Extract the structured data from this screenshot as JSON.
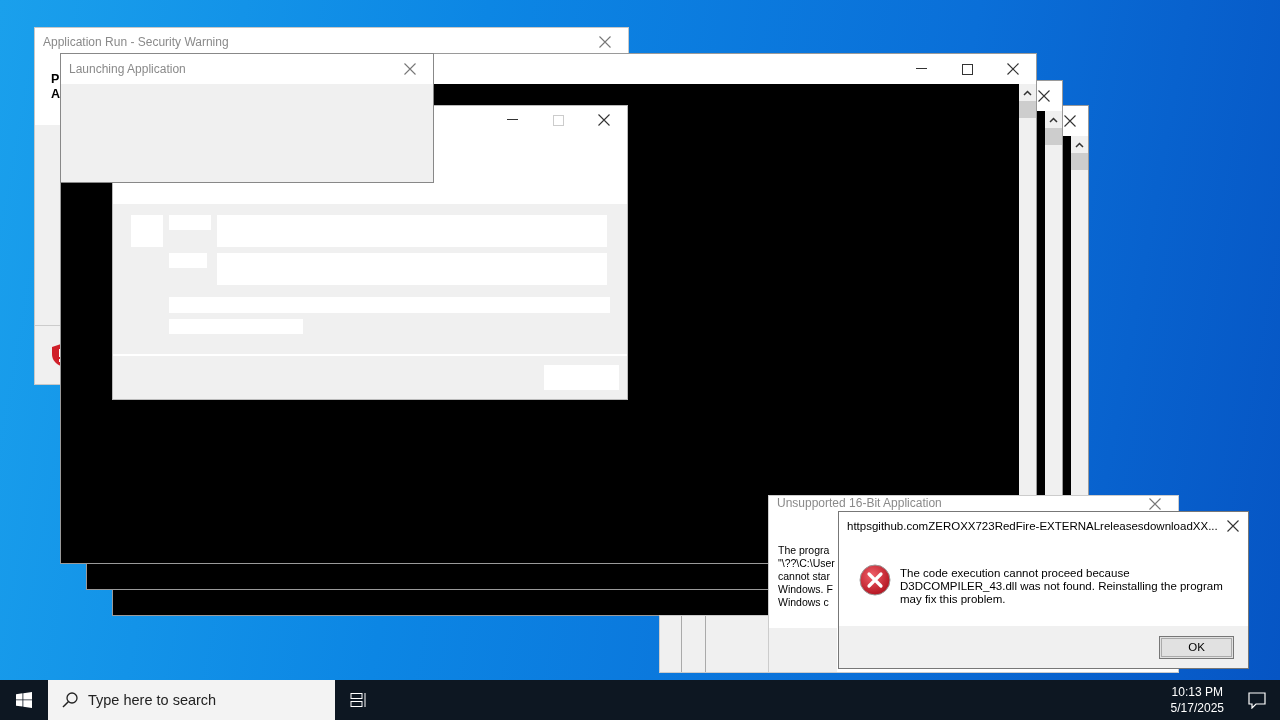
{
  "desktop": {
    "windows": [
      {
        "kind": "security",
        "title": "Application Run - Security Warning",
        "active": false,
        "heading_lines": [
          "P",
          "A"
        ]
      },
      {
        "kind": "console"
      },
      {
        "kind": "console"
      },
      {
        "kind": "console"
      },
      {
        "kind": "loading"
      },
      {
        "kind": "launching",
        "title": "Launching Application",
        "active": false
      },
      {
        "kind": "blank"
      },
      {
        "kind": "message",
        "title": "Unsupported 16-Bit Application",
        "active": false,
        "lines": [
          "The progra",
          "\"\\??\\C:\\User",
          "cannot star",
          "Windows. F",
          "Windows c"
        ]
      },
      {
        "kind": "error",
        "title": "httpsgithub.comZEROXX723RedFire-EXTERNALreleasesdownloadXX...",
        "active": true,
        "message": "The code execution cannot proceed because D3DCOMPILER_43.dll was not found. Reinstalling the program may fix this problem.",
        "button": "OK"
      }
    ]
  },
  "taskbar": {
    "search": {
      "placeholder": "Type here to search"
    },
    "time": "10:13 PM",
    "date": "5/17/2025"
  }
}
